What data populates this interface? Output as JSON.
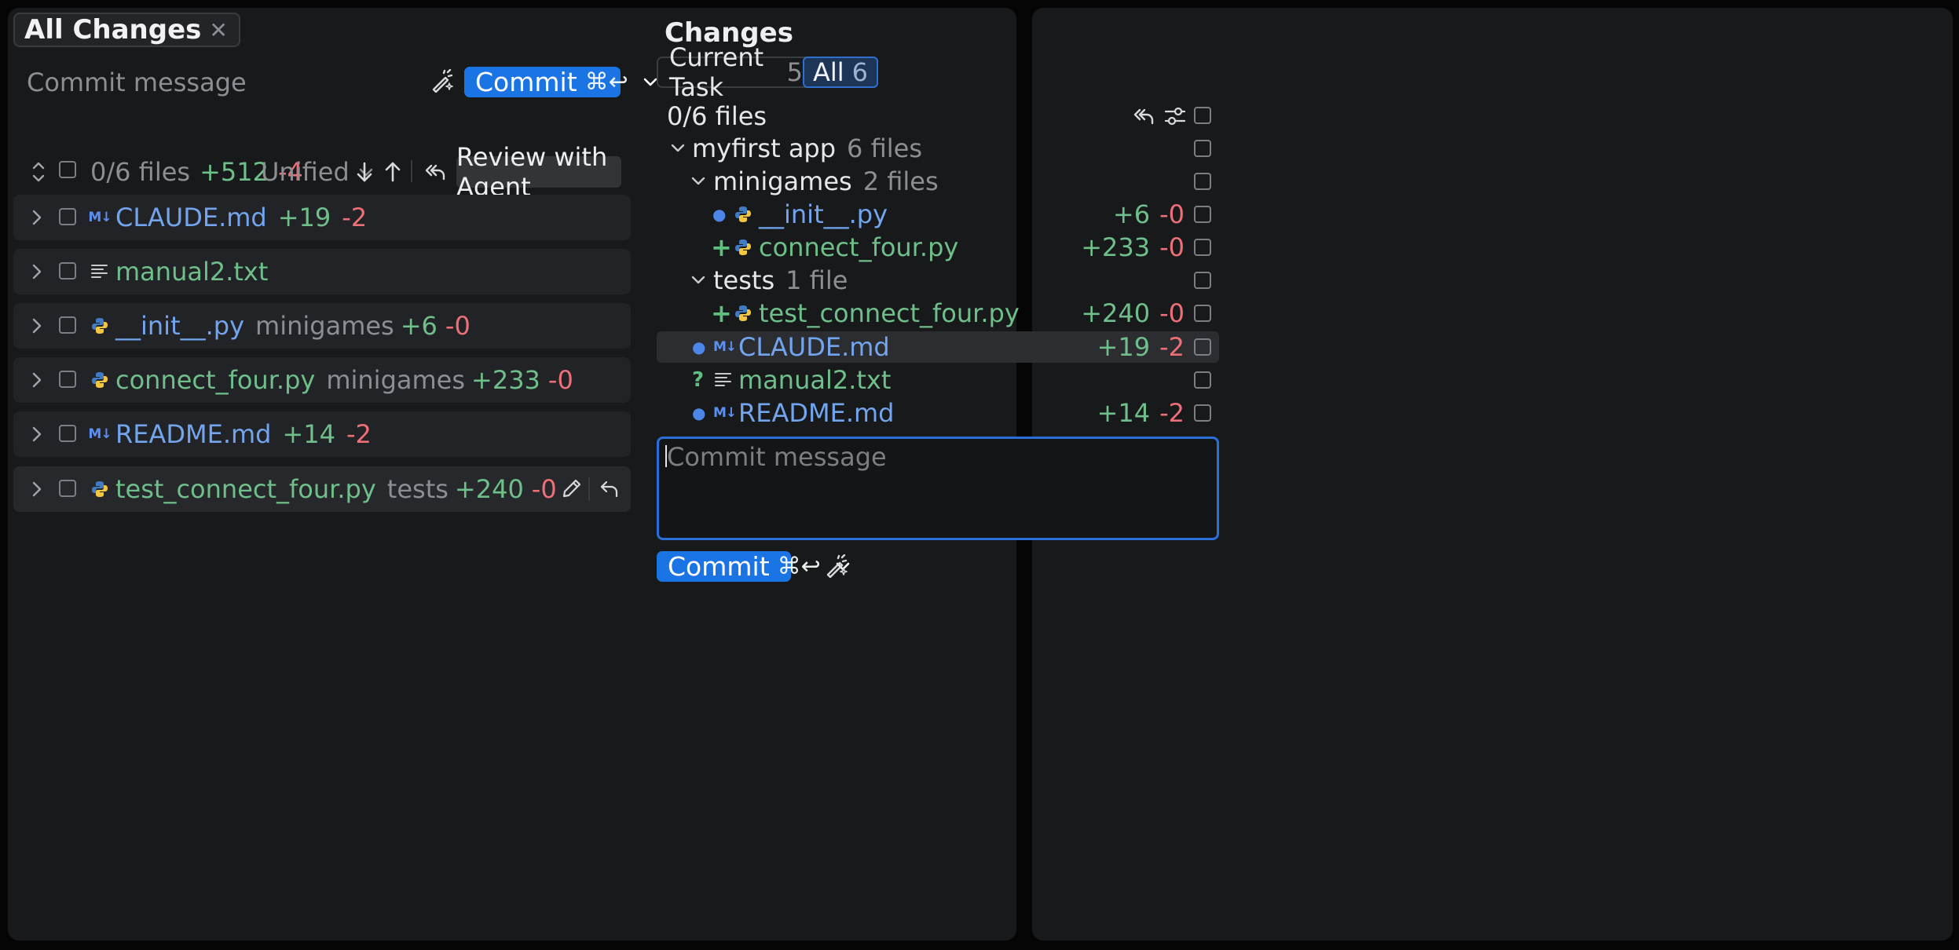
{
  "left": {
    "tab": {
      "label": "All Changes"
    },
    "commit_message_placeholder": "Commit message",
    "commit_button": {
      "label": "Commit",
      "shortcut": "⌘↩"
    },
    "toolbar": {
      "files": "0/6 files",
      "added": "+512",
      "removed": "-4",
      "view_mode": "Unified",
      "review_button": "Review with Agent"
    },
    "files": [
      {
        "name": "CLAUDE.md",
        "dir": "",
        "added": "+19",
        "removed": "-2",
        "icon": "markdown-icon",
        "color": "blue"
      },
      {
        "name": "manual2.txt",
        "dir": "",
        "added": "",
        "removed": "",
        "icon": "text-file-icon",
        "color": "green"
      },
      {
        "name": "__init__.py",
        "dir": "minigames",
        "added": "+6",
        "removed": "-0",
        "icon": "python-icon",
        "color": "blue"
      },
      {
        "name": "connect_four.py",
        "dir": "minigames",
        "added": "+233",
        "removed": "-0",
        "icon": "python-icon",
        "color": "green"
      },
      {
        "name": "README.md",
        "dir": "",
        "added": "+14",
        "removed": "-2",
        "icon": "markdown-icon",
        "color": "blue"
      },
      {
        "name": "test_connect_four.py",
        "dir": "tests",
        "added": "+240",
        "removed": "-0",
        "icon": "python-icon",
        "color": "green"
      }
    ]
  },
  "right": {
    "title": "Changes",
    "tabs": [
      {
        "label": "Current Task",
        "count": "5"
      },
      {
        "label": "All",
        "count": "6"
      }
    ],
    "files_count": "0/6 files",
    "tree": {
      "root": {
        "name": "myfirst app",
        "count": "6 files"
      },
      "minigames": {
        "name": "minigames",
        "count": "2 files"
      },
      "tests": {
        "name": "tests",
        "count": "1 file"
      },
      "init": {
        "status": "●",
        "name": "__init__.py",
        "added": "+6",
        "removed": "-0"
      },
      "connect_four": {
        "status": "+",
        "name": "connect_four.py",
        "added": "+233",
        "removed": "-0"
      },
      "test_connect_four": {
        "status": "+",
        "name": "test_connect_four.py",
        "added": "+240",
        "removed": "-0"
      },
      "claude": {
        "status": "●",
        "name": "CLAUDE.md",
        "added": "+19",
        "removed": "-2"
      },
      "manual": {
        "status": "?",
        "name": "manual2.txt",
        "added": "",
        "removed": ""
      },
      "readme": {
        "status": "●",
        "name": "README.md",
        "added": "+14",
        "removed": "-2"
      }
    },
    "commit_message_placeholder": "Commit message",
    "commit_button": {
      "label": "Commit",
      "shortcut": "⌘↩"
    }
  },
  "colors": {
    "accent": "#1a74e4",
    "added": "#6fbf8a",
    "removed": "#ef6f78",
    "modified_name": "#73a5ef",
    "new_name": "#6fbf8a"
  }
}
